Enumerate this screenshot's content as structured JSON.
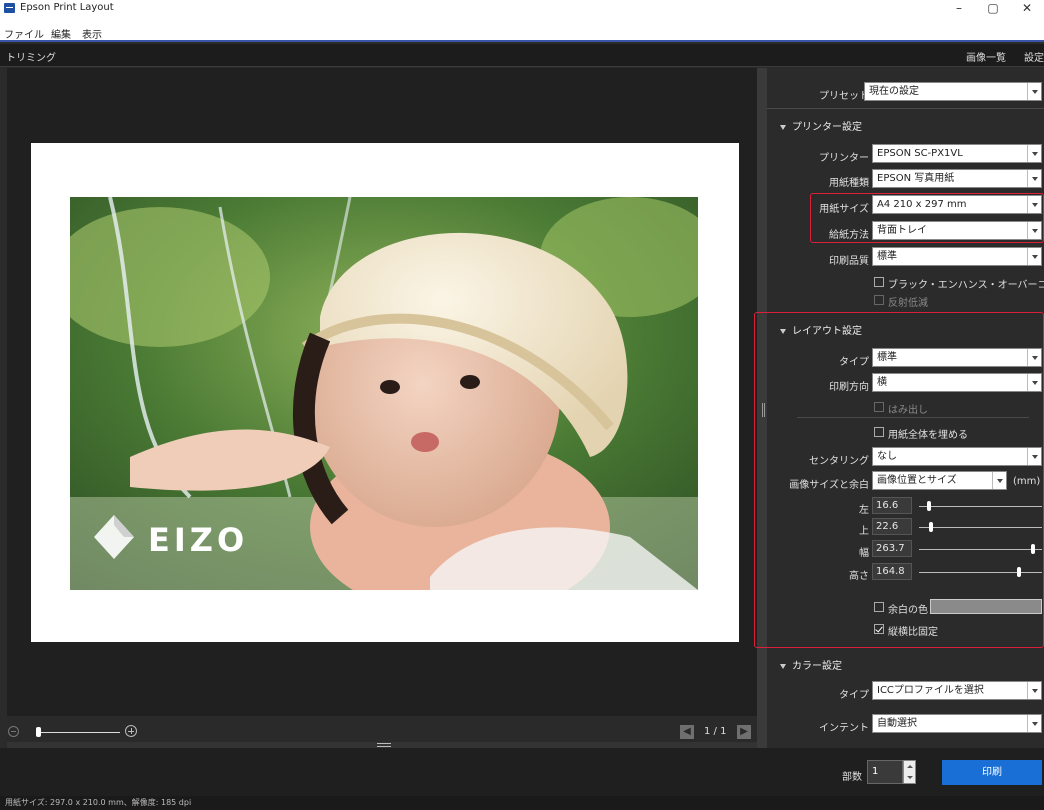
{
  "window": {
    "title": "Epson Print Layout",
    "minimize": "–",
    "maximize": "▢",
    "close": "✕"
  },
  "menu": {
    "file": "ファイル",
    "edit": "編集",
    "view": "表示"
  },
  "modebar": {
    "mode": "トリミング",
    "image_list": "画像一覧",
    "settings": "設定"
  },
  "preview": {
    "watermark": "EIZO",
    "page_indicator": "1 / 1",
    "prev": "◀",
    "next": "▶"
  },
  "panel": {
    "preset_label": "プリセット",
    "preset_value": "現在の設定",
    "printer_section": "プリンター設定",
    "printer_label": "プリンター",
    "printer_value": "EPSON SC-PX1VL",
    "paper_type_label": "用紙種類",
    "paper_type_value": "EPSON 写真用紙",
    "paper_size_label": "用紙サイズ",
    "paper_size_value": "A4 210 x 297 mm",
    "feed_label": "給紙方法",
    "feed_value": "背面トレイ",
    "quality_label": "印刷品質",
    "quality_value": "標準",
    "black_enhance": "ブラック・エンハンス・オーバーコート",
    "reflection": "反射低減",
    "layout_section": "レイアウト設定",
    "type_label": "タイプ",
    "type_value": "標準",
    "orientation_label": "印刷方向",
    "orientation_value": "横",
    "bleed": "はみ出し",
    "fill_paper": "用紙全体を埋める",
    "centering_label": "センタリング",
    "centering_value": "なし",
    "size_margin_label": "画像サイズと余白",
    "size_margin_value": "画像位置とサイズ",
    "unit": "(mm)",
    "left_label": "左",
    "left_value": "16.6",
    "left_slider": 0.08,
    "top_label": "上",
    "top_value": "22.6",
    "top_slider": 0.1,
    "width_label": "幅",
    "width_value": "263.7",
    "width_slider": 0.93,
    "height_label": "高さ",
    "height_value": "164.8",
    "height_slider": 0.81,
    "margin_color": "余白の色",
    "keep_ratio": "縦横比固定",
    "color_section": "カラー設定",
    "color_type_label": "タイプ",
    "color_type_value": "ICCプロファイルを選択",
    "intent_label": "インテント",
    "intent_value": "自動選択"
  },
  "print": {
    "copies_label": "部数",
    "copies_value": "1",
    "print_button": "印刷"
  },
  "status": {
    "text": "用紙サイズ: 297.0 x 210.0 mm、解像度: 185 dpi"
  },
  "colors": {
    "accent": "#1a6fd6",
    "highlight": "#d8203a",
    "panel_bg": "#2b2b2b"
  }
}
